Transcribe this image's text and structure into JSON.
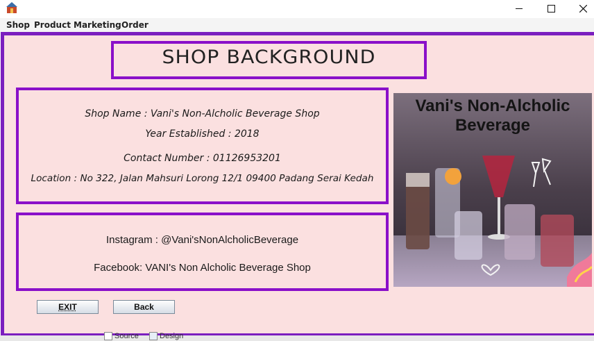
{
  "window": {
    "controls": {
      "minimize": "—",
      "maximize": "☐",
      "close": "✕"
    }
  },
  "menu": [
    "Shop",
    "Product",
    "Marketing",
    "Order"
  ],
  "heading": "SHOP BACKGROUND",
  "info": {
    "shop_name": "Shop Name : Vani's Non-Alcholic Beverage Shop",
    "year": "Year Established : 2018",
    "contact": "Contact Number : 01126953201",
    "location": "Location : No 322, Jalan Mahsuri  Lorong 12/1 09400 Padang Serai Kedah"
  },
  "social": {
    "instagram": "Instagram : @Vani'sNonAlcholicBeverage",
    "facebook": "Facebook: VANI's Non Alcholic Beverage Shop"
  },
  "image": {
    "title": "Vani's Non-Alcholic Beverage",
    "title_color": "#141414"
  },
  "buttons": {
    "exit": "EXIT",
    "back": "Back"
  },
  "ide_tabs": {
    "source": "Source",
    "design": "Design"
  },
  "colors": {
    "accent": "#8a10c9",
    "panel_bg": "#fbe0e0"
  }
}
